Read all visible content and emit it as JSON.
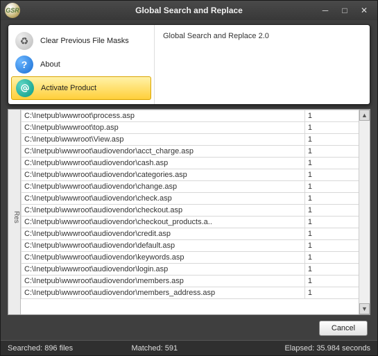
{
  "window": {
    "title": "Global Search and Replace",
    "app_icon_text": "GSR"
  },
  "menu": {
    "clear": "Clear Previous File Masks",
    "about": "About",
    "activate": "Activate Product",
    "tooltip": "Activate Product",
    "info_text": "Global Search and Replace 2.0"
  },
  "side_tab": "Res",
  "results": [
    {
      "path": "C:\\Inetpub\\wwwroot\\process.asp",
      "count": "1"
    },
    {
      "path": "C:\\Inetpub\\wwwroot\\top.asp",
      "count": "1"
    },
    {
      "path": "C:\\Inetpub\\wwwroot\\View.asp",
      "count": "1"
    },
    {
      "path": "C:\\Inetpub\\wwwroot\\audiovendor\\acct_charge.asp",
      "count": "1"
    },
    {
      "path": "C:\\Inetpub\\wwwroot\\audiovendor\\cash.asp",
      "count": "1"
    },
    {
      "path": "C:\\Inetpub\\wwwroot\\audiovendor\\categories.asp",
      "count": "1"
    },
    {
      "path": "C:\\Inetpub\\wwwroot\\audiovendor\\change.asp",
      "count": "1"
    },
    {
      "path": "C:\\Inetpub\\wwwroot\\audiovendor\\check.asp",
      "count": "1"
    },
    {
      "path": "C:\\Inetpub\\wwwroot\\audiovendor\\checkout.asp",
      "count": "1"
    },
    {
      "path": "C:\\Inetpub\\wwwroot\\audiovendor\\checkout_products.a..",
      "count": "1"
    },
    {
      "path": "C:\\Inetpub\\wwwroot\\audiovendor\\credit.asp",
      "count": "1"
    },
    {
      "path": "C:\\Inetpub\\wwwroot\\audiovendor\\default.asp",
      "count": "1"
    },
    {
      "path": "C:\\Inetpub\\wwwroot\\audiovendor\\keywords.asp",
      "count": "1"
    },
    {
      "path": "C:\\Inetpub\\wwwroot\\audiovendor\\login.asp",
      "count": "1"
    },
    {
      "path": "C:\\Inetpub\\wwwroot\\audiovendor\\members.asp",
      "count": "1"
    },
    {
      "path": "C:\\Inetpub\\wwwroot\\audiovendor\\members_address.asp",
      "count": "1"
    }
  ],
  "buttons": {
    "cancel": "Cancel"
  },
  "status": {
    "searched": "Searched: 896 files",
    "matched": "Matched: 591",
    "elapsed": "Elapsed: 35.984 seconds"
  }
}
